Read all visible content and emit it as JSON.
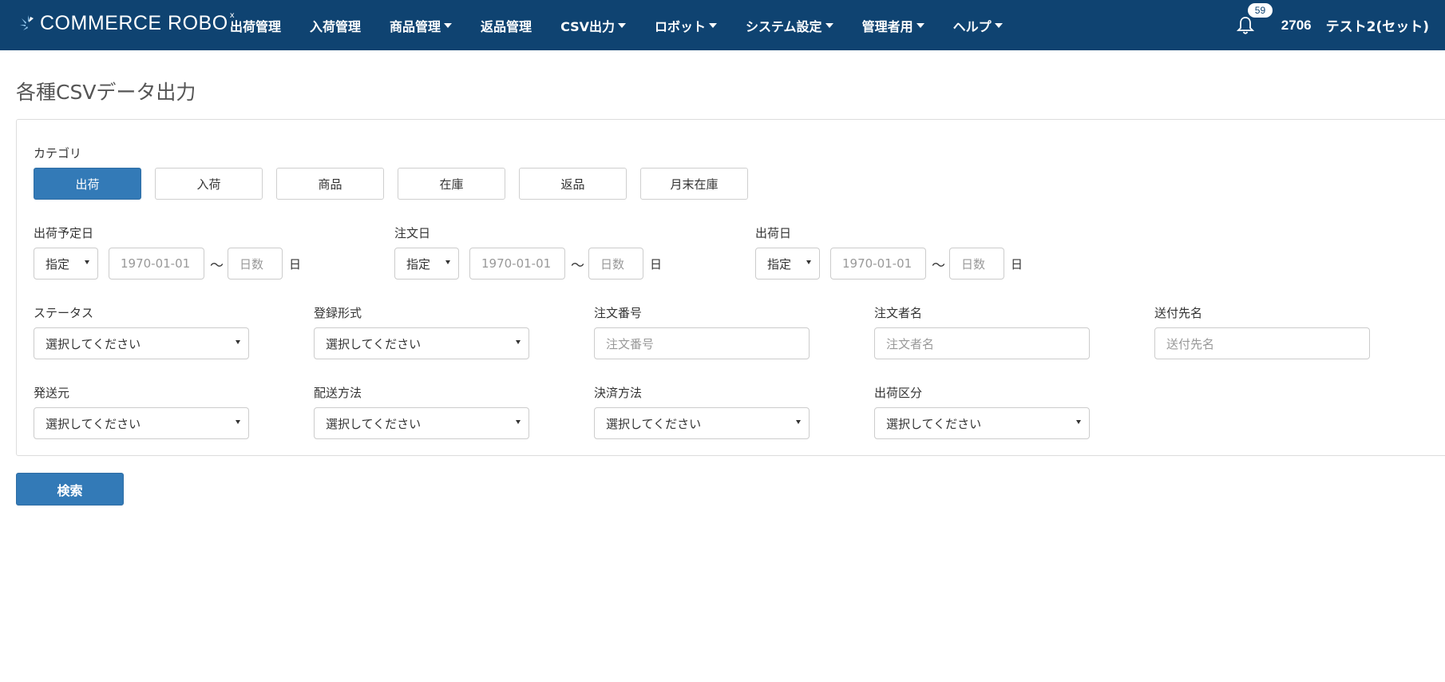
{
  "brand": {
    "name": "COMMERCE ROBO",
    "mark": "x"
  },
  "nav": {
    "items": [
      {
        "label": "出荷管理",
        "dropdown": false
      },
      {
        "label": "入荷管理",
        "dropdown": false
      },
      {
        "label": "商品管理",
        "dropdown": true
      },
      {
        "label": "返品管理",
        "dropdown": false
      },
      {
        "label": "CSV出力",
        "dropdown": true
      },
      {
        "label": "ロボット",
        "dropdown": true
      },
      {
        "label": "システム設定",
        "dropdown": true
      },
      {
        "label": "管理者用",
        "dropdown": true
      },
      {
        "label": "ヘルプ",
        "dropdown": true
      }
    ],
    "notification_count": "59",
    "user_id": "2706",
    "user_name": "テスト2(セット)"
  },
  "page": {
    "title": "各種CSVデータ出力"
  },
  "category": {
    "label": "カテゴリ",
    "buttons": [
      "出荷",
      "入荷",
      "商品",
      "在庫",
      "返品",
      "月末在庫"
    ],
    "active": "出荷"
  },
  "date_filters": [
    {
      "label": "出荷予定日",
      "mode": "指定",
      "date_placeholder": "1970-01-01",
      "tilde": "〜",
      "days_placeholder": "日数",
      "unit": "日"
    },
    {
      "label": "注文日",
      "mode": "指定",
      "date_placeholder": "1970-01-01",
      "tilde": "〜",
      "days_placeholder": "日数",
      "unit": "日"
    },
    {
      "label": "出荷日",
      "mode": "指定",
      "date_placeholder": "1970-01-01",
      "tilde": "〜",
      "days_placeholder": "日数",
      "unit": "日"
    }
  ],
  "fields_row1": [
    {
      "label": "ステータス",
      "type": "select",
      "value": "選択してください"
    },
    {
      "label": "登録形式",
      "type": "select",
      "value": "選択してください"
    },
    {
      "label": "注文番号",
      "type": "input",
      "placeholder": "注文番号"
    },
    {
      "label": "注文者名",
      "type": "input",
      "placeholder": "注文者名"
    },
    {
      "label": "送付先名",
      "type": "input",
      "placeholder": "送付先名"
    }
  ],
  "fields_row2": [
    {
      "label": "発送元",
      "type": "select",
      "value": "選択してください"
    },
    {
      "label": "配送方法",
      "type": "select",
      "value": "選択してください"
    },
    {
      "label": "決済方法",
      "type": "select",
      "value": "選択してください"
    },
    {
      "label": "出荷区分",
      "type": "select",
      "value": "選択してください"
    }
  ],
  "search_button": "検索",
  "colors": {
    "navbar": "#0f4371",
    "primary": "#337ab7"
  }
}
